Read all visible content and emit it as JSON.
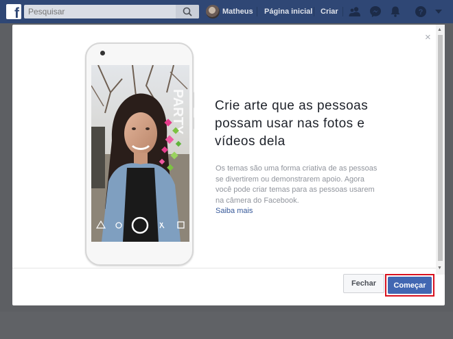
{
  "topbar": {
    "search_placeholder": "Pesquisar",
    "user_name": "Matheus",
    "home_label": "Página inicial",
    "create_label": "Criar",
    "icons": [
      "facebook-logo",
      "search-icon",
      "friends-icon",
      "messenger-icon",
      "notifications-icon",
      "help-icon",
      "dropdown-arrow-icon"
    ]
  },
  "dialog": {
    "close_symbol": "×",
    "heading": "Crie arte que as pessoas possam usar nas fotos e vídeos dela",
    "description": "Os temas são uma forma criativa de as pessoas se divertirem ou demonstrarem apoio. Agora você pode criar temas para as pessoas usarem na câmera do Facebook.",
    "learn_more": "Saiba mais",
    "buttons": {
      "close": "Fechar",
      "start": "Começar"
    },
    "highlight_color": "#d8101e"
  },
  "colors": {
    "topbar": "#2f4775",
    "primary_button": "#4267b2",
    "link": "#365899",
    "overlay": "#5d5f63"
  }
}
